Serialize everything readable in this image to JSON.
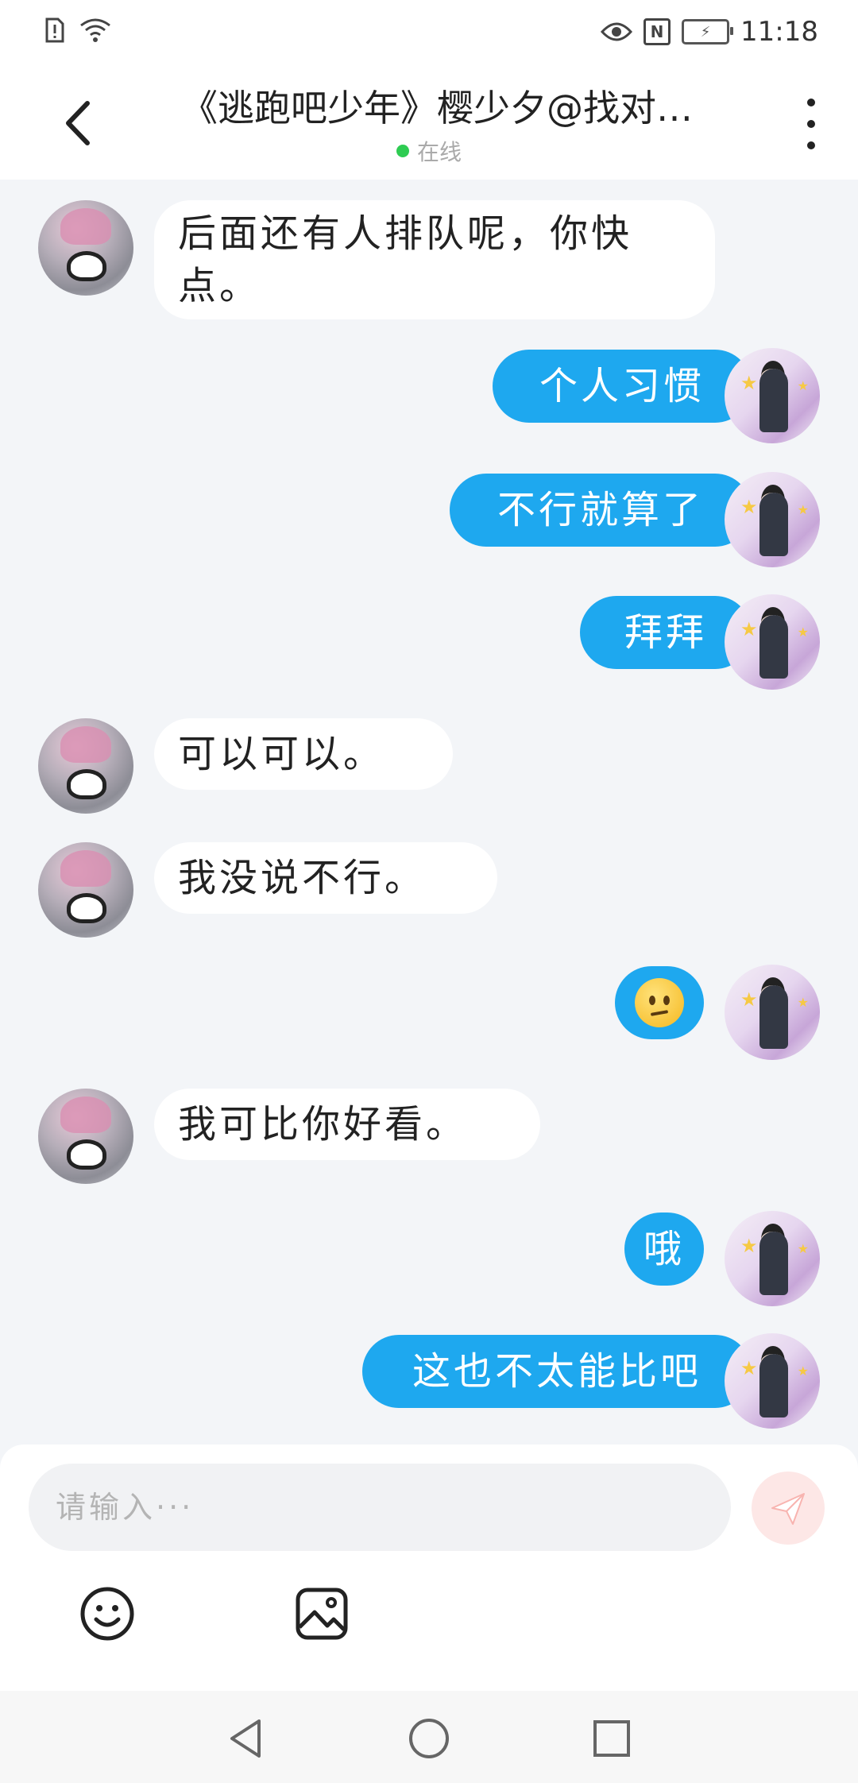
{
  "status_bar": {
    "time": "11:18",
    "icons": [
      "sim-alert-icon",
      "wifi-icon",
      "eye-icon",
      "nfc-icon",
      "battery-charging-icon"
    ],
    "nfc_label": "N"
  },
  "header": {
    "title": "《逃跑吧少年》樱少夕@找对…",
    "status": "在线",
    "status_color": "#2ecc52"
  },
  "messages": [
    {
      "side": "left",
      "text": "后面还有人排队呢，你快点。"
    },
    {
      "side": "right",
      "text": "个人习惯"
    },
    {
      "side": "right",
      "text": "不行就算了"
    },
    {
      "side": "right",
      "text": "拜拜"
    },
    {
      "side": "left",
      "text": "可以可以。"
    },
    {
      "side": "left",
      "text": "我没说不行。"
    },
    {
      "side": "right",
      "text": "",
      "emoji": "confused-face-emoji"
    },
    {
      "side": "left",
      "text": "我可比你好看。"
    },
    {
      "side": "right",
      "text": "哦"
    },
    {
      "side": "right",
      "text": "这也不太能比吧"
    }
  ],
  "input": {
    "placeholder": "请输入···",
    "value": ""
  },
  "toolbar": {
    "tools": [
      "emoji-icon",
      "image-icon"
    ]
  },
  "colors": {
    "accent": "#1ea8ef",
    "background": "#f3f5f8",
    "send_button": "#fde7e6"
  }
}
